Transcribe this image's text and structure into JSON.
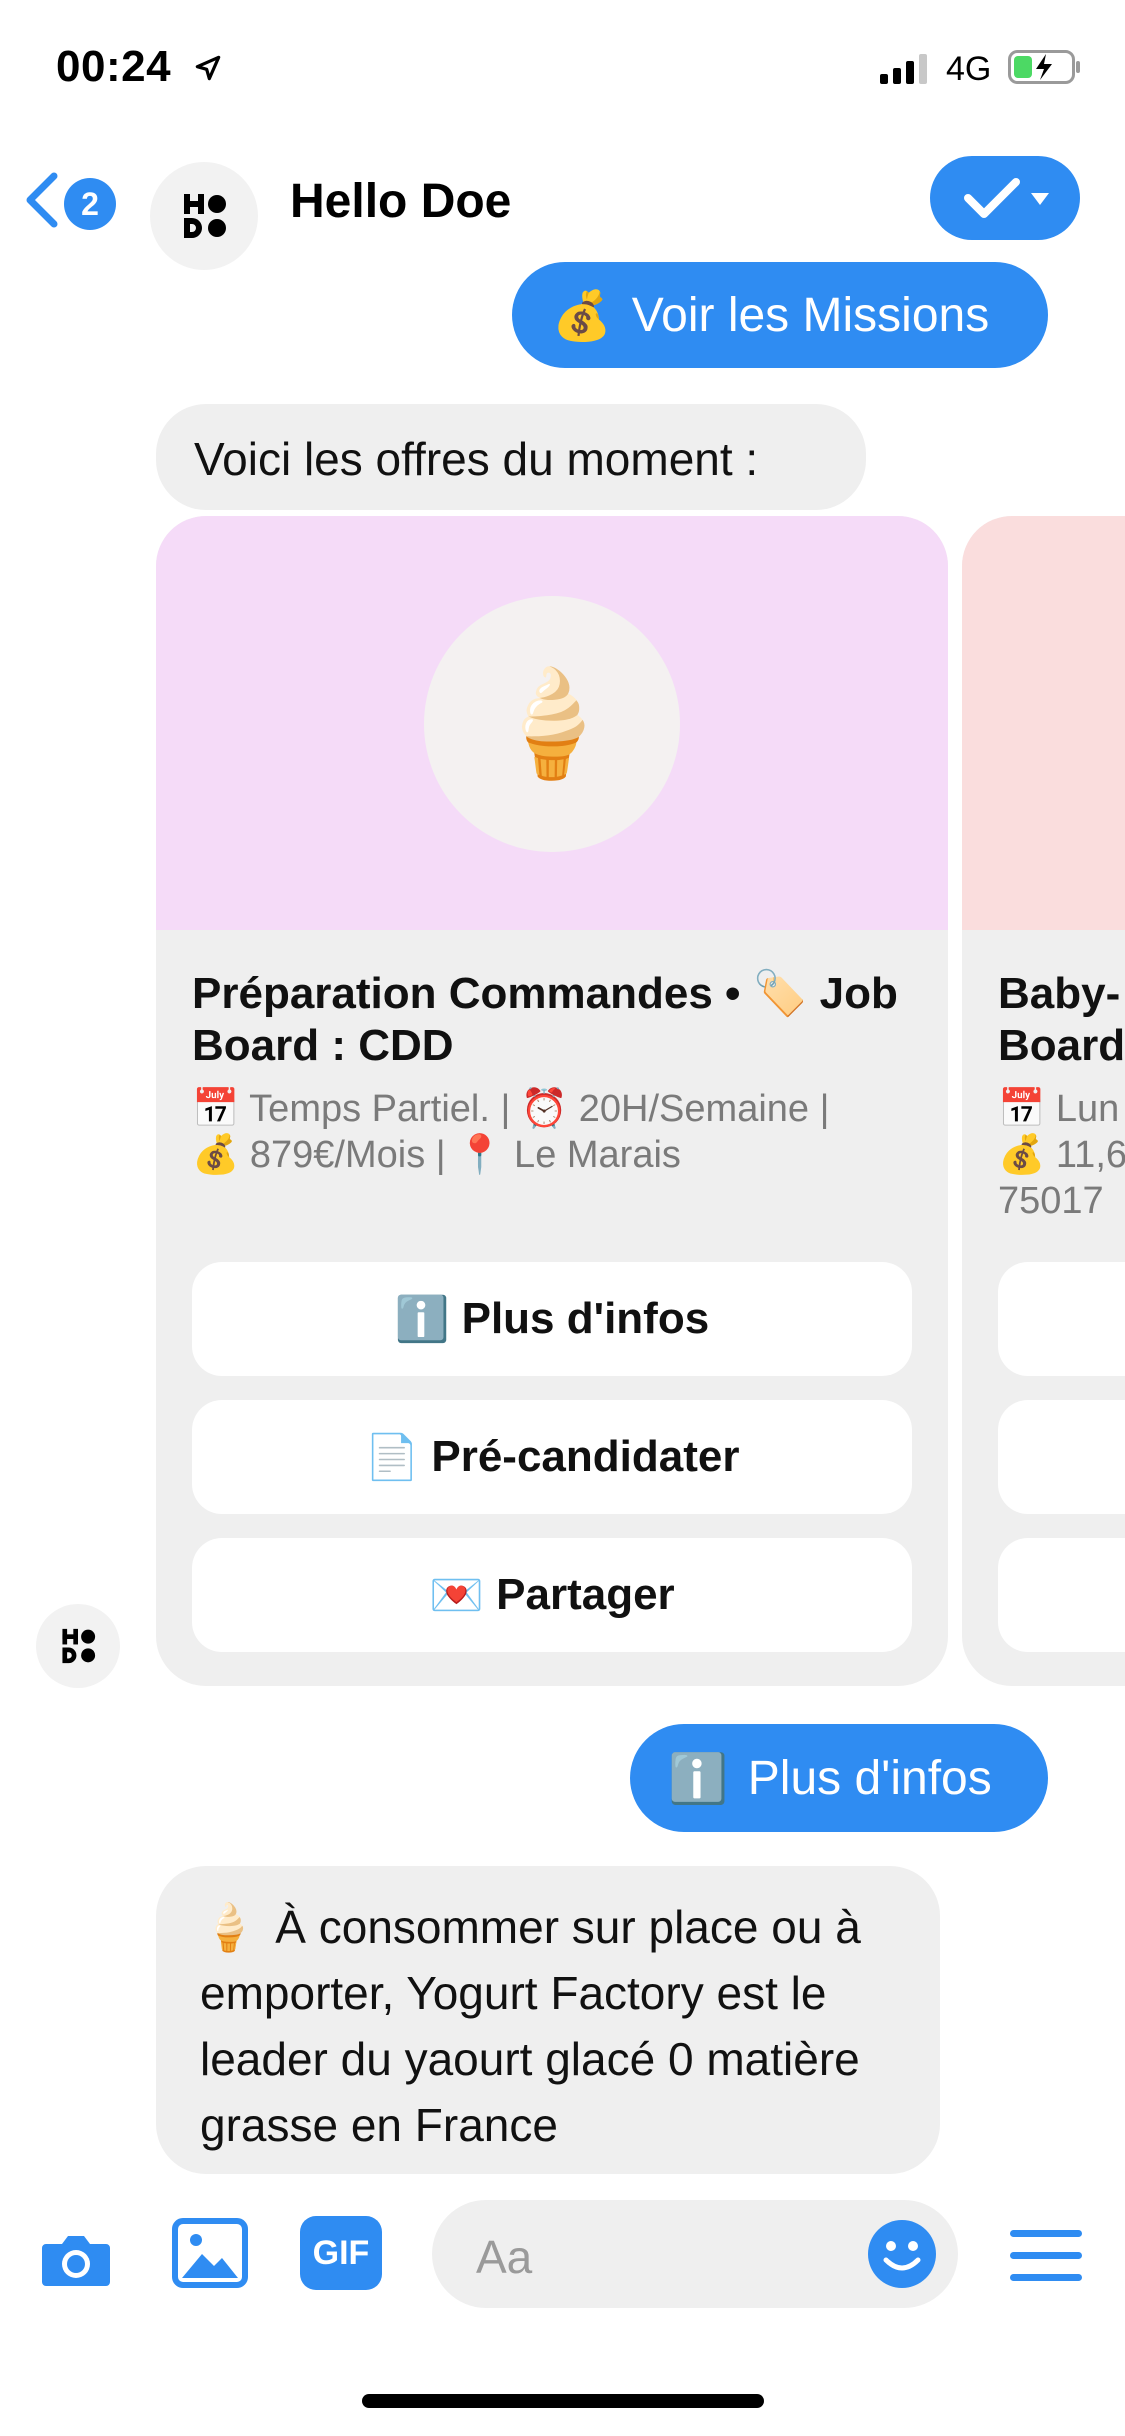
{
  "status_bar": {
    "time": "00:24",
    "network": "4G"
  },
  "header": {
    "back_badge": "2",
    "title": "Hello Doe"
  },
  "messages": {
    "missions_emoji": "💰",
    "missions": "Voir les Missions",
    "offres": "Voici les offres du moment :",
    "infos_sent_emoji": "ℹ️",
    "infos_sent": "Plus d'infos",
    "desc_emoji": "🍦",
    "desc": "À consommer sur place ou à emporter, Yogurt Factory est le leader du yaourt glacé 0 matière grasse en France"
  },
  "card": {
    "hero_emoji": "🍦",
    "title": "Préparation Commandes • 🏷️ Job Board : CDD",
    "sub_line1": "📅 Temps Partiel. | ⏰ 20H/Semaine |",
    "sub_line2": "💰 879€/Mois | 📍 Le Marais",
    "buttons": [
      {
        "emoji": "ℹ️",
        "label": "Plus d'infos"
      },
      {
        "emoji": "📄",
        "label": "Pré-candidater"
      },
      {
        "emoji": "💌",
        "label": "Partager"
      }
    ]
  },
  "card2": {
    "title_line1": "Baby-",
    "title_line2": "Board",
    "sub_line1": "📅 Lun",
    "sub_line2": "💰 11,6",
    "sub_line3": "75017"
  },
  "composer": {
    "gif_label": "GIF",
    "placeholder": "Aa"
  },
  "colors": {
    "accent": "#2f8cf2",
    "bubble_grey": "#efefef",
    "hero_pink": "#f5dbf8",
    "hero_rose": "#fadddd"
  }
}
